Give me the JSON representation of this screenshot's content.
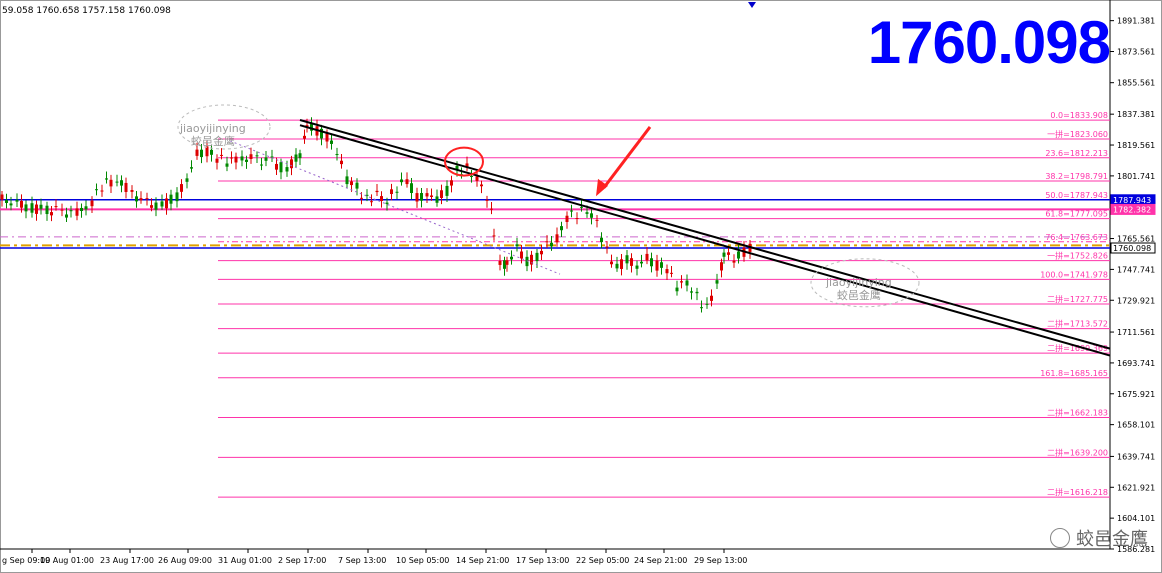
{
  "header": {
    "ohlc": "59.058 1760.658 1757.158 1760.098"
  },
  "current_price": "1760.098",
  "watermark": {
    "line1": "jiaoyijinying",
    "line2": "蛟邑金鹰"
  },
  "brand": {
    "text": "蛟邑金鷹"
  },
  "colors": {
    "bull": "#dd0000",
    "bear": "#008800",
    "fib": "#ff33aa",
    "blue": "#0000dd",
    "orange": "#e0a000",
    "trend": "#000000",
    "marker": "#ff2222"
  },
  "chart_data": {
    "type": "candlestick",
    "price_axis": [
      "1891.381",
      "1873.561",
      "1855.561",
      "1837.381",
      "1819.561",
      "1801.741",
      "1783.741",
      "1765.561",
      "1747.741",
      "1729.921",
      "1711.561",
      "1693.741",
      "1675.921",
      "1658.101",
      "1639.741",
      "1621.921",
      "1604.101",
      "1586.281"
    ],
    "time_labels": [
      "g Sep 09:00",
      "19 Aug 01:00",
      "23 Aug 17:00",
      "26 Aug 09:00",
      "31 Aug 01:00",
      "2 Sep 17:00",
      "7 Sep 13:00",
      "10 Sep 05:00",
      "14 Sep 21:00",
      "17 Sep 13:00",
      "22 Sep 05:00",
      "24 Sep 21:00",
      "29 Sep 13:00"
    ],
    "fib_levels": [
      {
        "label": "0.0=1833.908",
        "value": 1833.908
      },
      {
        "label": "一拼=1823.060",
        "value": 1823.06
      },
      {
        "label": "23.6=1812.213",
        "value": 1812.213
      },
      {
        "label": "38.2=1798.791",
        "value": 1798.791
      },
      {
        "label": "50.0=1787.943",
        "value": 1787.943
      },
      {
        "label": "61.8=1777.095",
        "value": 1777.095
      },
      {
        "label": "76.4=1763.673",
        "value": 1763.673
      },
      {
        "label": "一拼=1752.826",
        "value": 1752.826
      },
      {
        "label": "100.0=1741.978",
        "value": 1741.978
      },
      {
        "label": "二拼=1727.775",
        "value": 1727.775
      },
      {
        "label": "二拼=1713.572",
        "value": 1713.572
      },
      {
        "label": "二拼=1699.369",
        "value": 1699.369
      },
      {
        "label": "161.8=1685.165",
        "value": 1685.165
      },
      {
        "label": "二拼=1662.183",
        "value": 1662.183
      },
      {
        "label": "二拼=1639.200",
        "value": 1639.2
      },
      {
        "label": "二拼=1616.218",
        "value": 1616.218
      }
    ],
    "horizontal_lines": [
      {
        "label": "1787.943",
        "value": 1787.943,
        "color": "blue"
      },
      {
        "label": "1782.382",
        "value": 1782.382,
        "color": "fib"
      },
      {
        "label": "1760.098",
        "value": 1760.098,
        "color": "blue"
      }
    ],
    "price_range": [
      1586.281,
      1905
    ]
  }
}
